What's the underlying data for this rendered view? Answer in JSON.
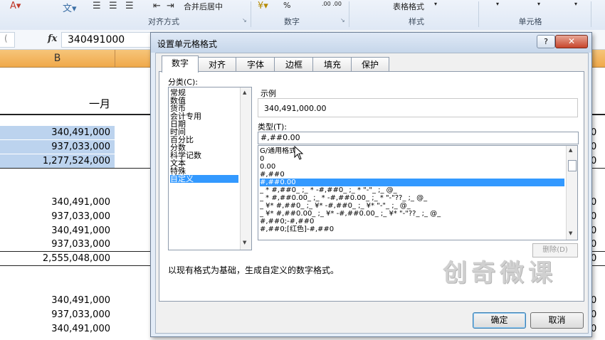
{
  "ribbon": {
    "groups": [
      "对齐方式",
      "数字",
      "样式",
      "单元格"
    ],
    "merge_center_label": "合并后居中",
    "table_format_label": "表格格式",
    "number_format_sample": ".00  .00",
    "percent_label": "%"
  },
  "formula_bar": {
    "fx_label": "fx",
    "value": "340491000"
  },
  "sheet": {
    "column_b_header": "B",
    "month_header": "一月",
    "right_edge_value": "0",
    "rows": [
      {
        "value": "340,491,000",
        "selected": true
      },
      {
        "value": "937,033,000",
        "selected": true
      },
      {
        "value": "1,277,524,000",
        "selected": true
      },
      {
        "value": "340,491,000",
        "selected": false
      },
      {
        "value": "937,033,000",
        "selected": false
      },
      {
        "value": "340,491,000",
        "selected": false
      },
      {
        "value": "937,033,000",
        "selected": false
      },
      {
        "value": "2,555,048,000",
        "selected": false
      },
      {
        "value": "340,491,000",
        "selected": false
      },
      {
        "value": "937,033,000",
        "selected": false
      },
      {
        "value": "340,491,000",
        "selected": false
      }
    ]
  },
  "dialog": {
    "title": "设置单元格格式",
    "help_label": "?",
    "close_label": "✕",
    "tabs": [
      "数字",
      "对齐",
      "字体",
      "边框",
      "填充",
      "保护"
    ],
    "active_tab": "数字",
    "category_label": "分类(C):",
    "categories": [
      "常规",
      "数值",
      "货币",
      "会计专用",
      "日期",
      "时间",
      "百分比",
      "分数",
      "科学记数",
      "文本",
      "特殊",
      "自定义"
    ],
    "selected_category": "自定义",
    "sample_label": "示例",
    "sample_value": "340,491,000.00",
    "type_label": "类型(T):",
    "type_value": "#,##0.00",
    "formats": [
      "G/通用格式",
      "0",
      "0.00",
      "#,##0",
      "#,##0.00",
      "_ * #,##0_ ;_ * -#,##0_ ;_ * \"-\"_ ;_ @_",
      "_ * #,##0.00_ ;_ * -#,##0.00_ ;_ * \"-\"??_ ;_ @_",
      "_ ¥* #,##0_ ;_ ¥* -#,##0_ ;_ ¥* \"-\"_ ;_ @_",
      "_ ¥* #,##0.00_ ;_ ¥* -#,##0.00_ ;_ ¥* \"-\"??_ ;_ @_",
      "#,##0;-#,##0",
      "#,##0;[红色]-#,##0"
    ],
    "selected_format": "#,##0.00",
    "delete_label": "删除(D)",
    "description": "以现有格式为基础，生成自定义的数字格式。",
    "ok_label": "确定",
    "cancel_label": "取消"
  },
  "watermark": "创奇微课"
}
